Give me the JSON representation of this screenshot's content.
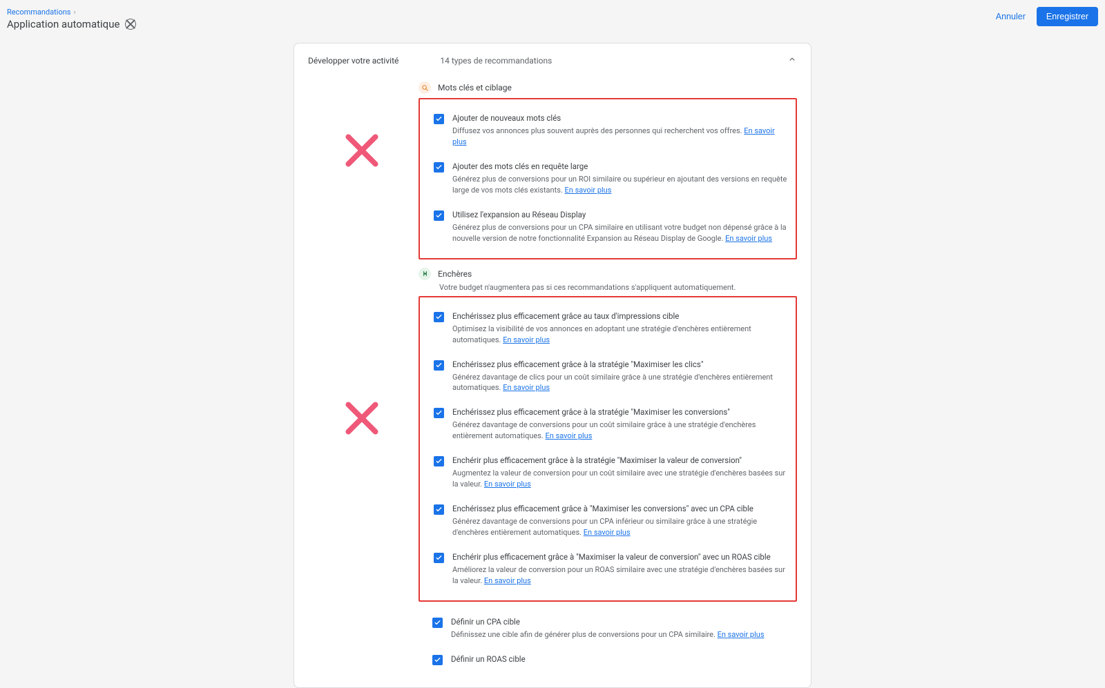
{
  "header": {
    "breadcrumb": "Recommandations",
    "title": "Application automatique",
    "cancel": "Annuler",
    "save": "Enregistrer"
  },
  "card": {
    "title": "Développer votre activité",
    "subtitle": "14 types de recommandations"
  },
  "learn_more": "En savoir plus",
  "sections": {
    "keywords": {
      "title": "Mots clés et ciblage",
      "items": [
        {
          "title": "Ajouter de nouveaux mots clés",
          "desc": "Diffusez vos annonces plus souvent auprès des personnes qui recherchent vos offres."
        },
        {
          "title": "Ajouter des mots clés en requête large",
          "desc": "Générez plus de conversions pour un ROI similaire ou supérieur en ajoutant des versions en requête large de vos mots clés existants."
        },
        {
          "title": "Utilisez l'expansion au Réseau Display",
          "desc": "Générez plus de conversions pour un CPA similaire en utilisant votre budget non dépensé grâce à la nouvelle version de notre fonctionnalité Expansion au Réseau Display de Google."
        }
      ]
    },
    "bidding": {
      "title": "Enchères",
      "note": "Votre budget n'augmentera pas si ces recommandations s'appliquent automatiquement.",
      "items_boxed": [
        {
          "title": "Enchérissez plus efficacement grâce au taux d'impressions cible",
          "desc": "Optimisez la visibilité de vos annonces en adoptant une stratégie d'enchères entièrement automatiques."
        },
        {
          "title": "Enchérissez plus efficacement grâce à la stratégie \"Maximiser les clics\"",
          "desc": "Générez davantage de clics pour un coût similaire grâce à une stratégie d'enchères entièrement automatiques."
        },
        {
          "title": "Enchérissez plus efficacement grâce à la stratégie \"Maximiser les conversions\"",
          "desc": "Générez davantage de conversions pour un coût similaire grâce à une stratégie d'enchères entièrement automatiques."
        },
        {
          "title": "Enchérir plus efficacement grâce à la stratégie \"Maximiser la valeur de conversion\"",
          "desc": "Augmentez la valeur de conversion pour un coût similaire avec une stratégie d'enchères basées sur la valeur."
        },
        {
          "title": "Enchérissez plus efficacement grâce à \"Maximiser les conversions\" avec un CPA cible",
          "desc": "Générez davantage de conversions pour un CPA inférieur ou similaire grâce à une stratégie d'enchères entièrement automatiques."
        },
        {
          "title": "Enchérir plus efficacement grâce à \"Maximiser la valeur de conversion\" avec un ROAS cible",
          "desc": "Améliorez la valeur de conversion pour un ROAS similaire avec une stratégie d'enchères basées sur la valeur."
        }
      ],
      "items_after": [
        {
          "title": "Définir un CPA cible",
          "desc": "Définissez une cible afin de générer plus de conversions pour un CPA similaire."
        },
        {
          "title": "Définir un ROAS cible",
          "desc": ""
        }
      ]
    }
  }
}
